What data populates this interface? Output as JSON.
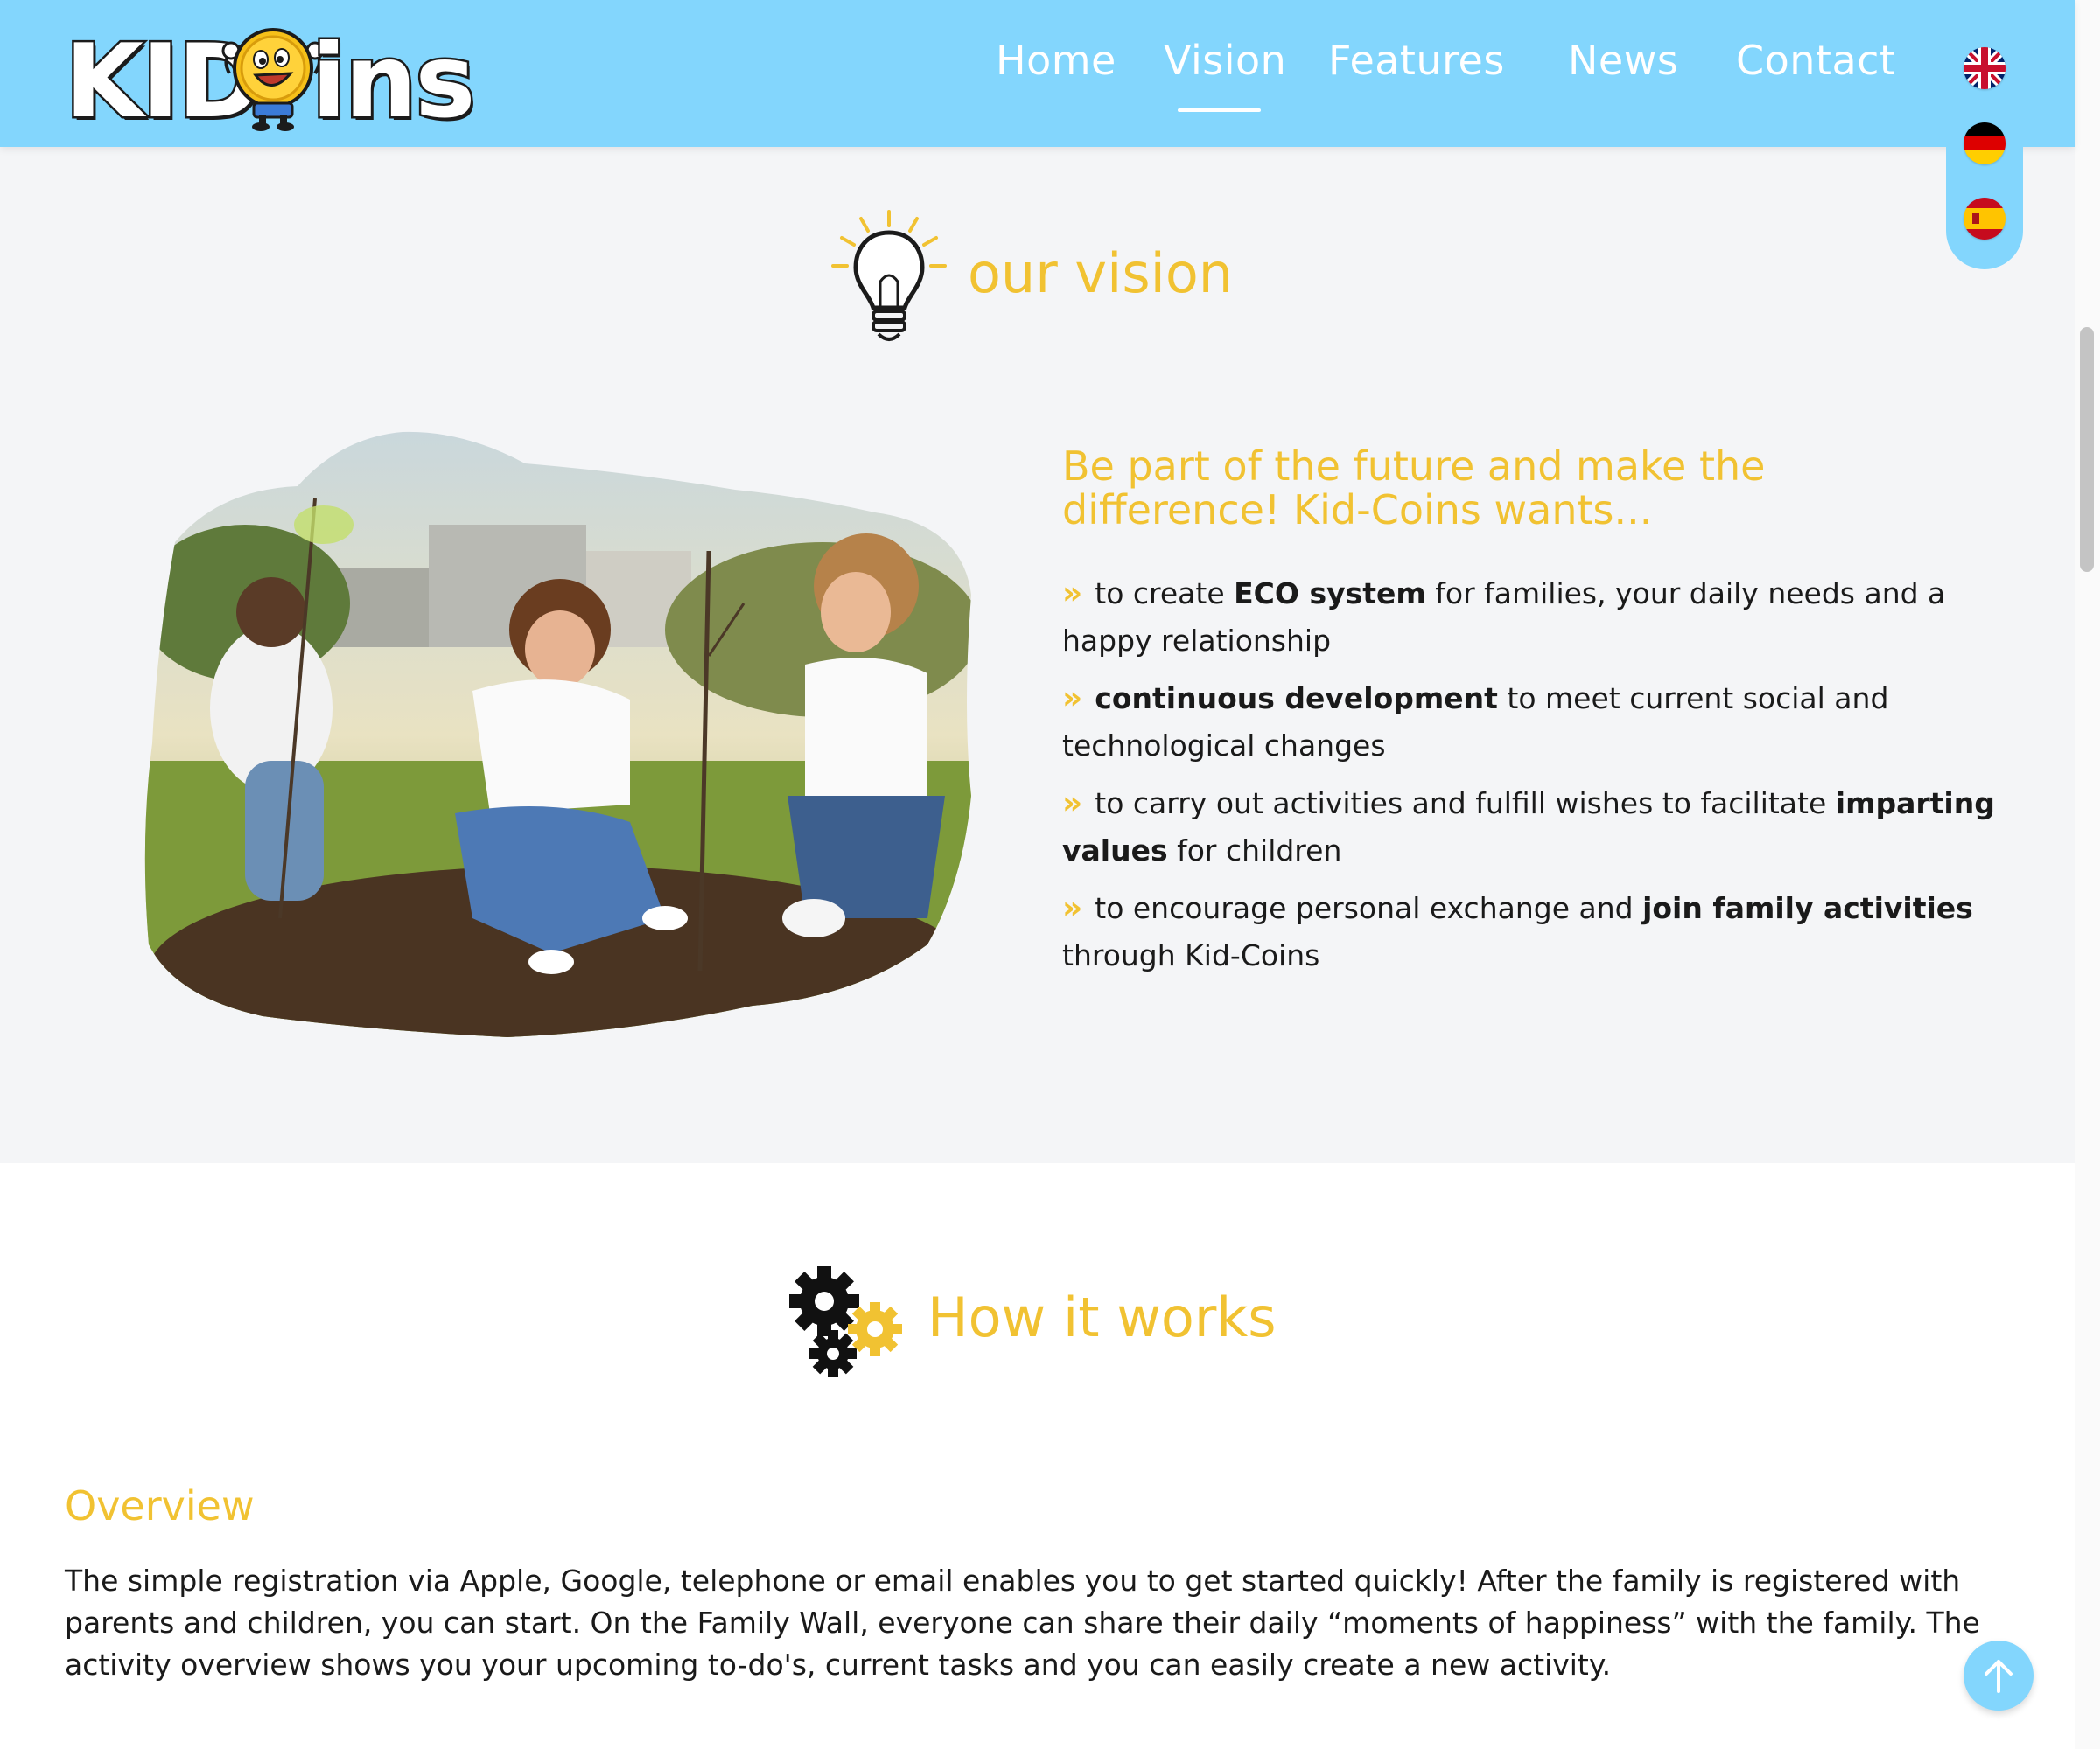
{
  "header": {
    "logo": {
      "text_left": "KID",
      "text_right": "ins",
      "alt": "KIDCoins"
    },
    "nav": [
      {
        "label": "Home",
        "active": false
      },
      {
        "label": "Vision",
        "active": true
      },
      {
        "label": "Features",
        "active": false
      },
      {
        "label": "News",
        "active": false
      },
      {
        "label": "Contact",
        "active": false
      }
    ],
    "languages": [
      {
        "code": "en",
        "icon": "uk-flag-icon"
      },
      {
        "code": "de",
        "icon": "germany-flag-icon"
      },
      {
        "code": "es",
        "icon": "spain-flag-icon"
      }
    ]
  },
  "vision": {
    "title": "our vision",
    "icon": "lightbulb-icon",
    "subheading": "Be part of the future and make the difference! Kid-Coins wants...",
    "bullets": [
      {
        "marker": "»",
        "before": "to create ",
        "bold": "ECO system",
        "after": " for families, your daily needs and a happy relationship"
      },
      {
        "marker": "»",
        "before": "",
        "bold": "continuous development",
        "after": " to meet current social and technological changes"
      },
      {
        "marker": "»",
        "before": "to carry out activities and fulfill wishes to facilitate ",
        "bold": "imparting values",
        "after": " for children"
      },
      {
        "marker": "»",
        "before": "to encourage personal exchange and ",
        "bold": "join family activities",
        "after": " through Kid-Coins"
      }
    ]
  },
  "how_it_works": {
    "title": "How it works",
    "icon": "gears-icon",
    "overview_title": "Overview",
    "overview_text": "The simple registration via Apple, Google, telephone or email enables you to get started quickly! After the family is registered with parents and children, you can start. On the Family Wall, everyone can share their daily “moments of happiness” with the family. The activity overview shows you your upcoming to-do's, current tasks and you can easily create a new activity."
  },
  "colors": {
    "header_bg": "#83d6fd",
    "accent_yellow": "#f1c232",
    "section_bg": "#f4f5f7",
    "text": "#1a1a1a"
  },
  "icons": {
    "scroll_top": "arrow-up-icon",
    "logo_mascot": "coin-mascot-icon"
  }
}
